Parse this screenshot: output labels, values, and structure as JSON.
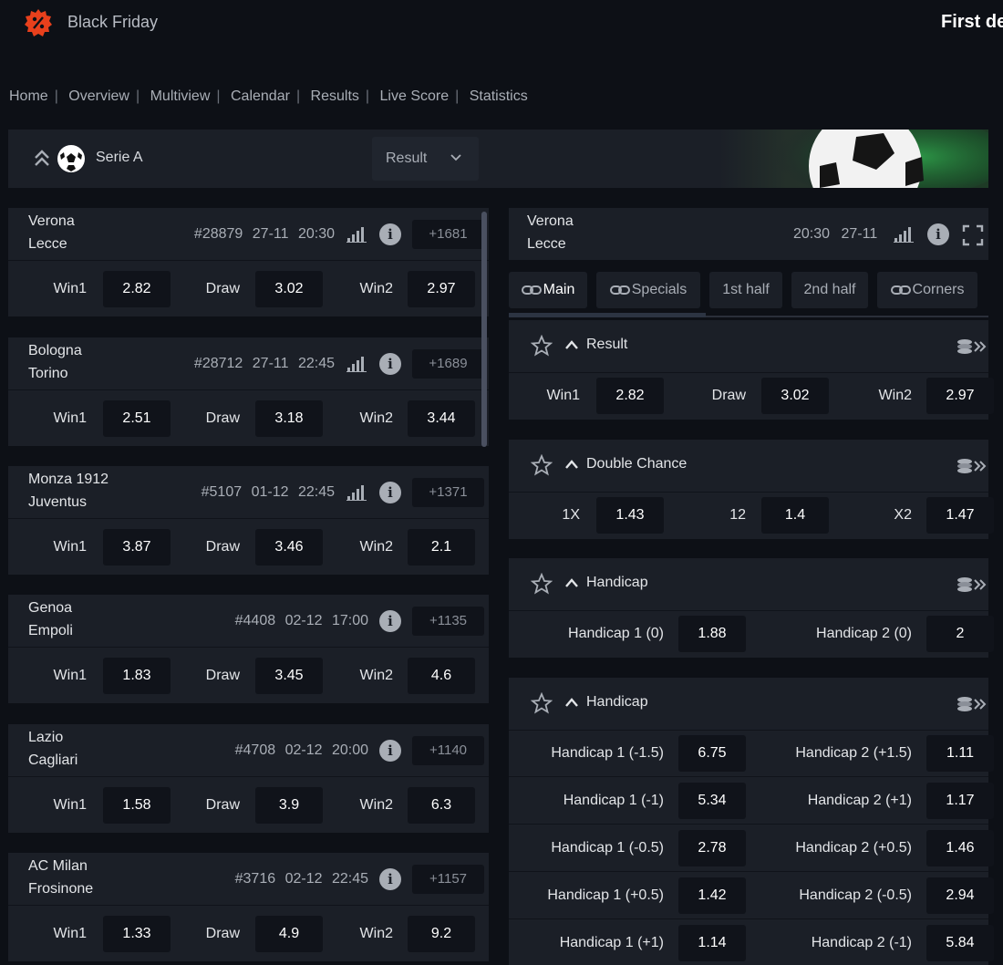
{
  "header": {
    "promo_label": "Black Friday",
    "promo_right": "First de"
  },
  "breadcrumb": [
    "Home",
    "Overview",
    "Multiview",
    "Calendar",
    "Results",
    "Live Score",
    "Statistics"
  ],
  "league": {
    "name": "Serie A",
    "market_select": "Result"
  },
  "events": [
    {
      "home": "Verona",
      "away": "Lecce",
      "id": "#28879",
      "date": "27-11",
      "time": "20:30",
      "stats": true,
      "more": "+1681",
      "odds": [
        {
          "label": "Win1",
          "value": "2.82"
        },
        {
          "label": "Draw",
          "value": "3.02"
        },
        {
          "label": "Win2",
          "value": "2.97"
        }
      ]
    },
    {
      "home": "Bologna",
      "away": "Torino",
      "id": "#28712",
      "date": "27-11",
      "time": "22:45",
      "stats": true,
      "more": "+1689",
      "odds": [
        {
          "label": "Win1",
          "value": "2.51"
        },
        {
          "label": "Draw",
          "value": "3.18"
        },
        {
          "label": "Win2",
          "value": "3.44"
        }
      ]
    },
    {
      "home": "Monza 1912",
      "away": "Juventus",
      "id": "#5107",
      "date": "01-12",
      "time": "22:45",
      "stats": true,
      "more": "+1371",
      "odds": [
        {
          "label": "Win1",
          "value": "3.87"
        },
        {
          "label": "Draw",
          "value": "3.46"
        },
        {
          "label": "Win2",
          "value": "2.1"
        }
      ]
    },
    {
      "home": "Genoa",
      "away": "Empoli",
      "id": "#4408",
      "date": "02-12",
      "time": "17:00",
      "stats": false,
      "more": "+1135",
      "odds": [
        {
          "label": "Win1",
          "value": "1.83"
        },
        {
          "label": "Draw",
          "value": "3.45"
        },
        {
          "label": "Win2",
          "value": "4.6"
        }
      ]
    },
    {
      "home": "Lazio",
      "away": "Cagliari",
      "id": "#4708",
      "date": "02-12",
      "time": "20:00",
      "stats": false,
      "more": "+1140",
      "odds": [
        {
          "label": "Win1",
          "value": "1.58"
        },
        {
          "label": "Draw",
          "value": "3.9"
        },
        {
          "label": "Win2",
          "value": "6.3"
        }
      ]
    },
    {
      "home": "AC Milan",
      "away": "Frosinone",
      "id": "#3716",
      "date": "02-12",
      "time": "22:45",
      "stats": false,
      "more": "+1157",
      "odds": [
        {
          "label": "Win1",
          "value": "1.33"
        },
        {
          "label": "Draw",
          "value": "4.9"
        },
        {
          "label": "Win2",
          "value": "9.2"
        }
      ]
    }
  ],
  "detail": {
    "home": "Verona",
    "away": "Lecce",
    "time": "20:30",
    "date": "27-11",
    "tabs": [
      {
        "label": "Main",
        "link": true
      },
      {
        "label": "Specials",
        "link": true
      },
      {
        "label": "1st half",
        "link": false
      },
      {
        "label": "2nd half",
        "link": false
      },
      {
        "label": "Corners",
        "link": true
      }
    ],
    "markets": [
      {
        "title": "Result",
        "rows": [
          [
            {
              "label": "Win1",
              "value": "2.82"
            },
            {
              "label": "Draw",
              "value": "3.02"
            },
            {
              "label": "Win2",
              "value": "2.97"
            }
          ]
        ]
      },
      {
        "title": "Double Chance",
        "rows": [
          [
            {
              "label": "1X",
              "value": "1.43"
            },
            {
              "label": "12",
              "value": "1.4"
            },
            {
              "label": "X2",
              "value": "1.47"
            }
          ]
        ]
      },
      {
        "title": "Handicap",
        "rows": [
          [
            {
              "label": "Handicap 1 (0)",
              "value": "1.88"
            },
            {
              "label": "Handicap 2 (0)",
              "value": "2"
            }
          ]
        ]
      },
      {
        "title": "Handicap",
        "rows": [
          [
            {
              "label": "Handicap 1 (-1.5)",
              "value": "6.75"
            },
            {
              "label": "Handicap 2 (+1.5)",
              "value": "1.11"
            }
          ],
          [
            {
              "label": "Handicap 1 (-1)",
              "value": "5.34"
            },
            {
              "label": "Handicap 2 (+1)",
              "value": "1.17"
            }
          ],
          [
            {
              "label": "Handicap 1 (-0.5)",
              "value": "2.78"
            },
            {
              "label": "Handicap 2 (+0.5)",
              "value": "1.46"
            }
          ],
          [
            {
              "label": "Handicap 1 (+0.5)",
              "value": "1.42"
            },
            {
              "label": "Handicap 2 (-0.5)",
              "value": "2.94"
            }
          ],
          [
            {
              "label": "Handicap 1 (+1)",
              "value": "1.14"
            },
            {
              "label": "Handicap 2 (-1)",
              "value": "5.84"
            }
          ]
        ]
      }
    ]
  },
  "colors": {
    "background": "#0d1016",
    "panel": "#1b1f27",
    "odd_button": "#10131a",
    "promo_accent": "#e8401c"
  }
}
